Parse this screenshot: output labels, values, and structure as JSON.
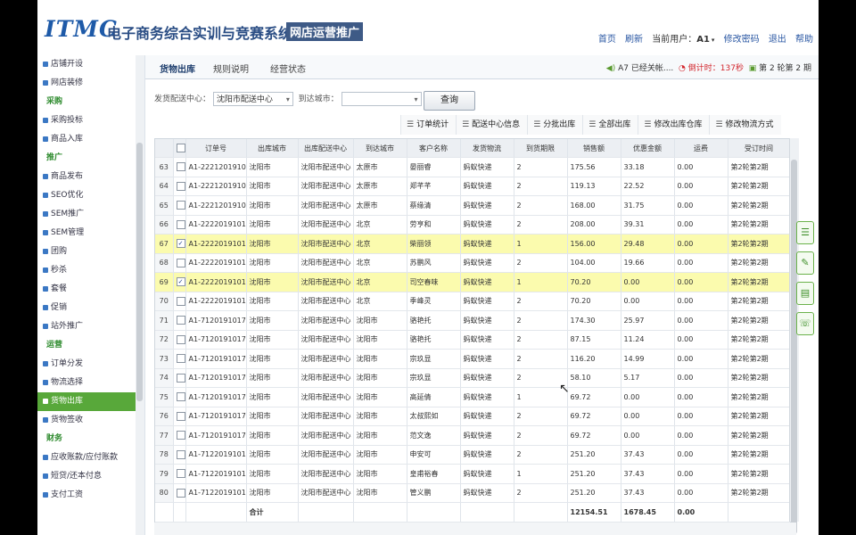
{
  "header": {
    "logo": "ITMC",
    "title": "电子商务综合实训与竞赛系统",
    "subtitle": "网店运营推广",
    "nav": {
      "home": "首页",
      "refresh": "刷新",
      "user_label": "当前用户：",
      "user": "A1",
      "change_pw": "修改密码",
      "logout": "退出",
      "help": "帮助"
    }
  },
  "sidebar": {
    "items": [
      {
        "label": "店铺开设",
        "type": "item"
      },
      {
        "label": "网店装修",
        "type": "item"
      },
      {
        "label": "采购",
        "type": "group"
      },
      {
        "label": "采购投标",
        "type": "item"
      },
      {
        "label": "商品入库",
        "type": "item"
      },
      {
        "label": "推广",
        "type": "group"
      },
      {
        "label": "商品发布",
        "type": "item"
      },
      {
        "label": "SEO优化",
        "type": "item"
      },
      {
        "label": "SEM推广",
        "type": "item"
      },
      {
        "label": "SEM管理",
        "type": "item"
      },
      {
        "label": "团购",
        "type": "item"
      },
      {
        "label": "秒杀",
        "type": "item"
      },
      {
        "label": "套餐",
        "type": "item"
      },
      {
        "label": "促销",
        "type": "item"
      },
      {
        "label": "站外推广",
        "type": "item"
      },
      {
        "label": "运营",
        "type": "group"
      },
      {
        "label": "订单分发",
        "type": "item"
      },
      {
        "label": "物流选择",
        "type": "item"
      },
      {
        "label": "货物出库",
        "type": "active"
      },
      {
        "label": "货物签收",
        "type": "item"
      },
      {
        "label": "财务",
        "type": "group"
      },
      {
        "label": "应收账款/应付账款",
        "type": "item"
      },
      {
        "label": "短贷/还本付息",
        "type": "item"
      },
      {
        "label": "支付工资",
        "type": "item"
      }
    ]
  },
  "tabs": [
    "货物出库",
    "规则说明",
    "经营状态"
  ],
  "status": {
    "msg": "A7 已经关帐....",
    "timer_label": "倒计时：",
    "timer": "137秒",
    "round": "第 2 轮第 2 期"
  },
  "filters": {
    "center_label": "发货配送中心：",
    "center_value": "沈阳市配送中心",
    "city_label": "到达城市：",
    "city_value": "",
    "query": "查询"
  },
  "toolbar": [
    "订单统计",
    "配送中心信息",
    "分批出库",
    "全部出库",
    "修改出库仓库",
    "修改物流方式"
  ],
  "columns": [
    "",
    "",
    "订单号",
    "出库城市",
    "出库配送中心",
    "到达城市",
    "客户名称",
    "发货物流",
    "到货期限",
    "销售额",
    "优惠金额",
    "运费",
    "受订时间"
  ],
  "rows": [
    {
      "n": "63",
      "c": false,
      "id": "A1-2221201910171",
      "oc": "沈阳市",
      "dc": "沈阳市配送中心",
      "ac": "太原市",
      "cu": "晏丽睿",
      "lg": "蚂蚁快递",
      "dl": "2",
      "sa": "175.56",
      "di": "33.18",
      "fr": "0.00",
      "t": "第2轮第2期"
    },
    {
      "n": "64",
      "c": false,
      "id": "A1-2221201910171",
      "oc": "沈阳市",
      "dc": "沈阳市配送中心",
      "ac": "太原市",
      "cu": "郑芊芊",
      "lg": "蚂蚁快递",
      "dl": "2",
      "sa": "119.13",
      "di": "22.52",
      "fr": "0.00",
      "t": "第2轮第2期"
    },
    {
      "n": "65",
      "c": false,
      "id": "A1-2221201910171",
      "oc": "沈阳市",
      "dc": "沈阳市配送中心",
      "ac": "太原市",
      "cu": "蔡缘清",
      "lg": "蚂蚁快递",
      "dl": "2",
      "sa": "168.00",
      "di": "31.75",
      "fr": "0.00",
      "t": "第2轮第2期"
    },
    {
      "n": "66",
      "c": false,
      "id": "A1-2222019101701",
      "oc": "沈阳市",
      "dc": "沈阳市配送中心",
      "ac": "北京",
      "cu": "劳亨和",
      "lg": "蚂蚁快递",
      "dl": "2",
      "sa": "208.00",
      "di": "39.31",
      "fr": "0.00",
      "t": "第2轮第2期"
    },
    {
      "n": "67",
      "c": true,
      "id": "A1-2222019101701",
      "oc": "沈阳市",
      "dc": "沈阳市配送中心",
      "ac": "北京",
      "cu": "柴丽领",
      "lg": "蚂蚁快递",
      "dl": "1",
      "sa": "156.00",
      "di": "29.48",
      "fr": "0.00",
      "t": "第2轮第2期"
    },
    {
      "n": "68",
      "c": false,
      "id": "A1-2222019101701",
      "oc": "沈阳市",
      "dc": "沈阳市配送中心",
      "ac": "北京",
      "cu": "苏鹏风",
      "lg": "蚂蚁快递",
      "dl": "2",
      "sa": "104.00",
      "di": "19.66",
      "fr": "0.00",
      "t": "第2轮第2期"
    },
    {
      "n": "69",
      "c": true,
      "id": "A1-2222019101701",
      "oc": "沈阳市",
      "dc": "沈阳市配送中心",
      "ac": "北京",
      "cu": "司空春味",
      "lg": "蚂蚁快递",
      "dl": "1",
      "sa": "70.20",
      "di": "0.00",
      "fr": "0.00",
      "t": "第2轮第2期"
    },
    {
      "n": "70",
      "c": false,
      "id": "A1-2222019101701",
      "oc": "沈阳市",
      "dc": "沈阳市配送中心",
      "ac": "北京",
      "cu": "季峰灵",
      "lg": "蚂蚁快递",
      "dl": "2",
      "sa": "70.20",
      "di": "0.00",
      "fr": "0.00",
      "t": "第2轮第2期"
    },
    {
      "n": "71",
      "c": false,
      "id": "A1-7120191017001",
      "oc": "沈阳市",
      "dc": "沈阳市配送中心",
      "ac": "沈阳市",
      "cu": "骆艳托",
      "lg": "蚂蚁快递",
      "dl": "2",
      "sa": "174.30",
      "di": "25.97",
      "fr": "0.00",
      "t": "第2轮第2期"
    },
    {
      "n": "72",
      "c": false,
      "id": "A1-7120191017001",
      "oc": "沈阳市",
      "dc": "沈阳市配送中心",
      "ac": "沈阳市",
      "cu": "骆艳托",
      "lg": "蚂蚁快递",
      "dl": "2",
      "sa": "87.15",
      "di": "11.24",
      "fr": "0.00",
      "t": "第2轮第2期"
    },
    {
      "n": "73",
      "c": false,
      "id": "A1-7120191017001",
      "oc": "沈阳市",
      "dc": "沈阳市配送中心",
      "ac": "沈阳市",
      "cu": "宗玖显",
      "lg": "蚂蚁快递",
      "dl": "2",
      "sa": "116.20",
      "di": "14.99",
      "fr": "0.00",
      "t": "第2轮第2期"
    },
    {
      "n": "74",
      "c": false,
      "id": "A1-7120191017001",
      "oc": "沈阳市",
      "dc": "沈阳市配送中心",
      "ac": "沈阳市",
      "cu": "宗玖显",
      "lg": "蚂蚁快递",
      "dl": "2",
      "sa": "58.10",
      "di": "5.17",
      "fr": "0.00",
      "t": "第2轮第2期"
    },
    {
      "n": "75",
      "c": false,
      "id": "A1-7120191017001",
      "oc": "沈阳市",
      "dc": "沈阳市配送中心",
      "ac": "沈阳市",
      "cu": "高延倩",
      "lg": "蚂蚁快递",
      "dl": "1",
      "sa": "69.72",
      "di": "0.00",
      "fr": "0.00",
      "t": "第2轮第2期"
    },
    {
      "n": "76",
      "c": false,
      "id": "A1-7120191017001",
      "oc": "沈阳市",
      "dc": "沈阳市配送中心",
      "ac": "沈阳市",
      "cu": "太叔熙如",
      "lg": "蚂蚁快递",
      "dl": "2",
      "sa": "69.72",
      "di": "0.00",
      "fr": "0.00",
      "t": "第2轮第2期"
    },
    {
      "n": "77",
      "c": false,
      "id": "A1-7120191017001",
      "oc": "沈阳市",
      "dc": "沈阳市配送中心",
      "ac": "沈阳市",
      "cu": "范文逸",
      "lg": "蚂蚁快递",
      "dl": "2",
      "sa": "69.72",
      "di": "0.00",
      "fr": "0.00",
      "t": "第2轮第2期"
    },
    {
      "n": "78",
      "c": false,
      "id": "A1-7122019101700",
      "oc": "沈阳市",
      "dc": "沈阳市配送中心",
      "ac": "沈阳市",
      "cu": "申安可",
      "lg": "蚂蚁快递",
      "dl": "2",
      "sa": "251.20",
      "di": "37.43",
      "fr": "0.00",
      "t": "第2轮第2期"
    },
    {
      "n": "79",
      "c": false,
      "id": "A1-7122019101700",
      "oc": "沈阳市",
      "dc": "沈阳市配送中心",
      "ac": "沈阳市",
      "cu": "皇甫裕春",
      "lg": "蚂蚁快递",
      "dl": "1",
      "sa": "251.20",
      "di": "37.43",
      "fr": "0.00",
      "t": "第2轮第2期"
    },
    {
      "n": "80",
      "c": false,
      "id": "A1-7122019101700",
      "oc": "沈阳市",
      "dc": "沈阳市配送中心",
      "ac": "沈阳市",
      "cu": "管义鹏",
      "lg": "蚂蚁快递",
      "dl": "2",
      "sa": "251.20",
      "di": "37.43",
      "fr": "0.00",
      "t": "第2轮第2期"
    }
  ],
  "total": {
    "label": "合计",
    "sales": "12154.51",
    "discount": "1678.45",
    "freight": "0.00"
  },
  "icons": {
    "speaker": "speaker-icon",
    "timer": "clock-icon",
    "calendar": "calendar-icon"
  }
}
